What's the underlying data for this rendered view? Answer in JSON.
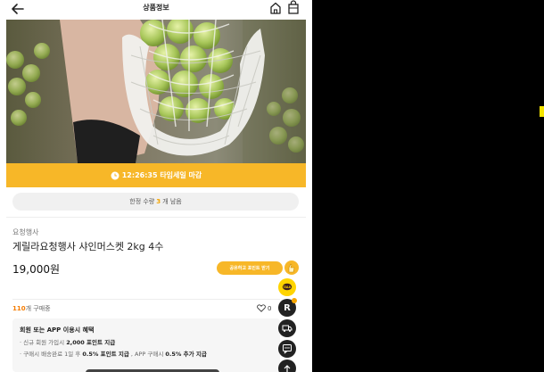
{
  "header": {
    "title": "상품정보"
  },
  "icons": {
    "back": "back-arrow-icon",
    "home": "home-icon",
    "bag": "shopping-bag-icon",
    "clock": "clock-icon",
    "share": "share-hand-icon",
    "talk": "kakao-talk-icon",
    "recent": "recent-view-icon",
    "delivery": "delivery-truck-icon",
    "sms": "message-icon",
    "top": "scroll-top-icon",
    "heart": "heart-icon"
  },
  "timer": {
    "text": "12:26:35 타임세일 마감"
  },
  "stock": {
    "prefix": "한정 수량",
    "count": "3",
    "suffix": "개 남음"
  },
  "product": {
    "seller": "요청행사",
    "name": "게릴라요청행사 샤인머스켓 2kg 4수",
    "price": "19,000원"
  },
  "share": {
    "label": "공유하고 포인트 받기"
  },
  "purchase": {
    "count": "110",
    "suffix": "개 구매중",
    "likes": "0"
  },
  "fab": {
    "recent_label": "R"
  },
  "benefits": {
    "title": "회원 또는 APP 이용시 혜택",
    "line1_prefix": "· 신규 회원 가입시 ",
    "line1_bold": "2,000 포인트 지급",
    "line2_prefix": "· 구매시 배송완료 1일 후 ",
    "line2_bold1": "0.5% 포인트 지급",
    "line2_mid": " , APP 구매시 ",
    "line2_bold2": "0.5% 추가 지급"
  },
  "colors": {
    "accent": "#f7b728",
    "count": "#f57c00",
    "dark": "#222222"
  }
}
